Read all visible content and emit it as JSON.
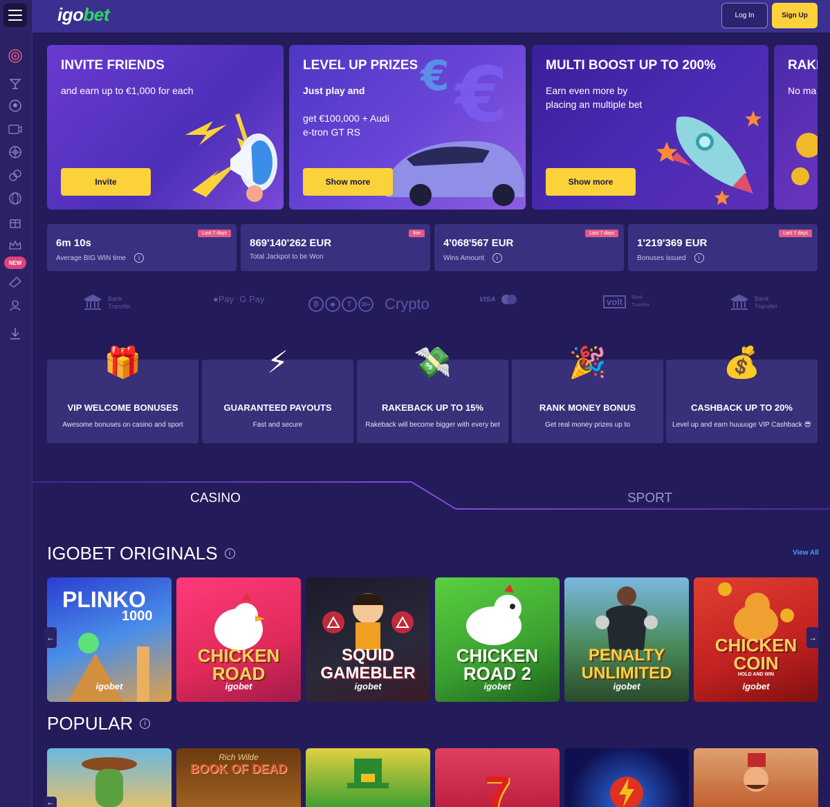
{
  "header": {
    "logo_prefix": "igo",
    "logo_suffix": "bet",
    "login_label": "Log In",
    "signup_label": "Sign Up"
  },
  "sidebar": {
    "new_badge": "NEW"
  },
  "banners": [
    {
      "title": "INVITE FRIENDS",
      "text": "and earn up to €1,000 for each",
      "button": "Invite"
    },
    {
      "title": "LEVEL UP PRIZES",
      "text1": "Just play and",
      "text2": "get €100,000 + Audi\ne-tron GT RS",
      "button": "Show more"
    },
    {
      "title": "MULTI BOOST UP TO 200%",
      "text": "Earn even more by\nplacing an multiple bet",
      "button": "Show more"
    },
    {
      "title": "RAKI",
      "text": "No ma"
    }
  ],
  "stats": [
    {
      "value": "6m 10s",
      "label": "Average BIG WIN time",
      "badge": "Last 7 days"
    },
    {
      "value": "869'140'262 EUR",
      "label": "Total Jackpot to be Won",
      "badge": "live"
    },
    {
      "value": "4'068'567 EUR",
      "label": "Wins Amount",
      "badge": "Last 7 days"
    },
    {
      "value": "1'219'369 EUR",
      "label": "Bonuses issued",
      "badge": "Last 7 days"
    }
  ],
  "payments": {
    "bank1": "Bank\nTransfer",
    "applepay": "Pay",
    "gpay": "G Pay",
    "crypto": "Crypto",
    "crypto_more": "30+",
    "visa": "VISA",
    "volt": "volt",
    "volt_sub": "Bank\nTransfer",
    "bank2": "Bank\nTransfer"
  },
  "features": [
    {
      "title": "VIP WELCOME BONUSES",
      "desc": "Awesome bonuses on casino and sport"
    },
    {
      "title": "GUARANTEED PAYOUTS",
      "desc": "Fast and secure"
    },
    {
      "title": "RAKEBACK UP TO 15%",
      "desc": "Rakeback will become bigger with every bet"
    },
    {
      "title": "RANK MONEY BONUS",
      "desc": "Get real money prizes up to"
    },
    {
      "title": "CASHBACK UP TO 20%",
      "desc": "Level up and earn huuuuge VIP Cashback 😎"
    }
  ],
  "tabs": {
    "casino": "CASINO",
    "sport": "SPORT"
  },
  "originals": {
    "title": "IGOBET ORIGINALS",
    "view_all": "View All",
    "games": [
      {
        "name": "PLINKO",
        "sub": "1000",
        "brand": "igobet"
      },
      {
        "name": "CHICKEN\nROAD",
        "brand": "igobet"
      },
      {
        "name": "SQUID\nGAMEBLER",
        "brand": "igobet"
      },
      {
        "name": "CHICKEN\nROAD 2",
        "brand": "igobet"
      },
      {
        "name": "PENALTY\nUNLIMITED",
        "brand": "igobet"
      },
      {
        "name": "CHICKEN\nCOIN",
        "sub": "HOLD AND WIN",
        "brand": "igobet"
      }
    ]
  },
  "popular": {
    "title": "POPULAR",
    "game2_title": "BOOK OF DEAD",
    "game2_sub": "Rich Wilde"
  },
  "colors": {
    "background": "#231b5a",
    "accent_yellow": "#fbd23a",
    "logo_green": "#29d95f",
    "badge_pink": "#e35a86",
    "link_blue": "#3fa8ff"
  }
}
